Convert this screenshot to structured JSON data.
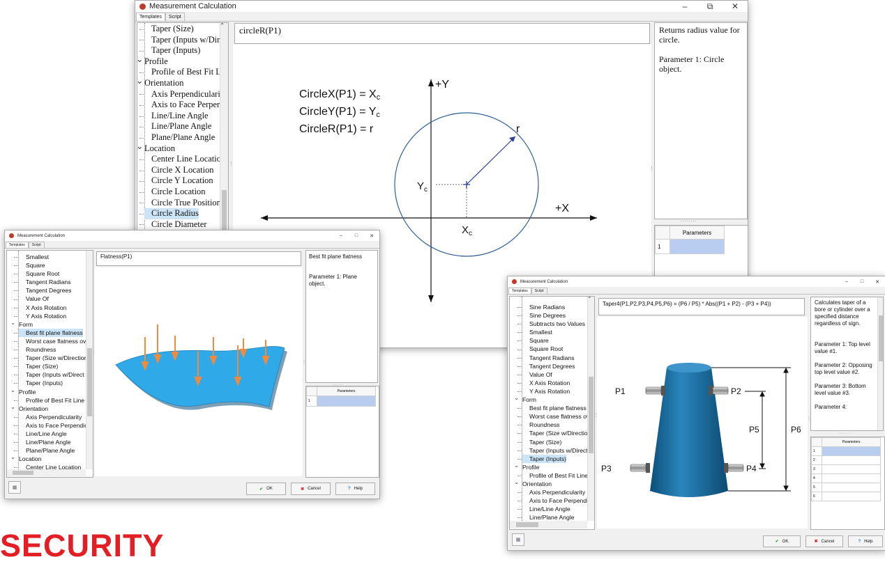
{
  "watermark_text": "SECURITY",
  "window_back": {
    "title": "Measurement Calculation",
    "tabs": [
      "Templates",
      "Script"
    ],
    "tree": [
      {
        "label": "Taper (Size)",
        "kind": "child"
      },
      {
        "label": "Taper (Inputs w/Dir",
        "kind": "child"
      },
      {
        "label": "Taper (Inputs)",
        "kind": "child"
      },
      {
        "label": "Profile",
        "kind": "cat"
      },
      {
        "label": "Profile of Best Fit L",
        "kind": "child"
      },
      {
        "label": "Orientation",
        "kind": "cat"
      },
      {
        "label": "Axis Perpendiculari",
        "kind": "child"
      },
      {
        "label": "Axis to Face Perper",
        "kind": "child"
      },
      {
        "label": "Line/Line Angle",
        "kind": "child"
      },
      {
        "label": "Line/Plane Angle",
        "kind": "child"
      },
      {
        "label": "Plane/Plane Angle",
        "kind": "child"
      },
      {
        "label": "Location",
        "kind": "cat"
      },
      {
        "label": "Center Line Locatio",
        "kind": "child"
      },
      {
        "label": "Circle X Location",
        "kind": "child"
      },
      {
        "label": "Circle Y Location",
        "kind": "child"
      },
      {
        "label": "Circle Location",
        "kind": "child"
      },
      {
        "label": "Circle True Position",
        "kind": "child"
      },
      {
        "label": "Circle Radius",
        "kind": "child",
        "selected": true
      },
      {
        "label": "Circle Diameter",
        "kind": "child"
      }
    ],
    "formula": "circleR(P1)",
    "description": [
      "Returns radius value for circle.",
      "Parameter 1: Circle object."
    ],
    "params_header": "Parameters",
    "param_rows": [
      "1"
    ],
    "diagram": {
      "eq1": "CircleX(P1) = X",
      "eq2": "CircleY(P1) = Y",
      "eq3": "CircleR(P1) = r",
      "sub": "c",
      "axis_y": "+Y",
      "axis_x": "+X",
      "r_label": "r",
      "yc": "Y",
      "xc": "X"
    }
  },
  "window_left": {
    "title": "Measurement Calculation",
    "tabs": [
      "Templates",
      "Script"
    ],
    "tree": [
      {
        "label": "Smallest",
        "kind": "child"
      },
      {
        "label": "Square",
        "kind": "child"
      },
      {
        "label": "Square Root",
        "kind": "child"
      },
      {
        "label": "Tangent Radians",
        "kind": "child"
      },
      {
        "label": "Tangent Degrees",
        "kind": "child"
      },
      {
        "label": "Value Of",
        "kind": "child"
      },
      {
        "label": "X Axis Rotation",
        "kind": "child"
      },
      {
        "label": "Y Axis Rotation",
        "kind": "child"
      },
      {
        "label": "Form",
        "kind": "cat"
      },
      {
        "label": "Best fit plane flatness",
        "kind": "child",
        "selected": true
      },
      {
        "label": "Worst case flatness ove",
        "kind": "child"
      },
      {
        "label": "Roundness",
        "kind": "child"
      },
      {
        "label": "Taper (Size w/Directior",
        "kind": "child"
      },
      {
        "label": "Taper (Size)",
        "kind": "child"
      },
      {
        "label": "Taper (Inputs w/Direct",
        "kind": "child"
      },
      {
        "label": "Taper (Inputs)",
        "kind": "child"
      },
      {
        "label": "Profile",
        "kind": "cat"
      },
      {
        "label": "Profile of Best Fit Line",
        "kind": "child"
      },
      {
        "label": "Orientation",
        "kind": "cat"
      },
      {
        "label": "Axis Perpendicularity",
        "kind": "child"
      },
      {
        "label": "Axis to Face Perpendic",
        "kind": "child"
      },
      {
        "label": "Line/Line Angle",
        "kind": "child"
      },
      {
        "label": "Line/Plane Angle",
        "kind": "child"
      },
      {
        "label": "Plane/Plane Angle",
        "kind": "child"
      },
      {
        "label": "Location",
        "kind": "cat"
      },
      {
        "label": "Center Line Location",
        "kind": "child"
      }
    ],
    "formula": "Flatness(P1)",
    "description": [
      "Best fit plane flatness",
      "Parameter 1: Plane object."
    ],
    "params_header": "Parameters",
    "param_rows": [
      "1"
    ],
    "buttons": {
      "ok": "OK",
      "cancel": "Cancel",
      "help": "Help"
    }
  },
  "window_right": {
    "title": "Measurement Calculation",
    "tabs": [
      "Templates",
      "Script"
    ],
    "tree": [
      {
        "label": "Sine Radians",
        "kind": "child"
      },
      {
        "label": "Sine Degrees",
        "kind": "child"
      },
      {
        "label": "Subtracts two Values",
        "kind": "child"
      },
      {
        "label": "Smallest",
        "kind": "child"
      },
      {
        "label": "Square",
        "kind": "child"
      },
      {
        "label": "Square Root",
        "kind": "child"
      },
      {
        "label": "Tangent Radians",
        "kind": "child"
      },
      {
        "label": "Tangent Degrees",
        "kind": "child"
      },
      {
        "label": "Value Of",
        "kind": "child"
      },
      {
        "label": "X Axis Rotation",
        "kind": "child"
      },
      {
        "label": "Y Axis Rotation",
        "kind": "child"
      },
      {
        "label": "Form",
        "kind": "cat"
      },
      {
        "label": "Best fit plane flatness",
        "kind": "child"
      },
      {
        "label": "Worst case flatness ove",
        "kind": "child"
      },
      {
        "label": "Roundness",
        "kind": "child"
      },
      {
        "label": "Taper (Size w/Directior",
        "kind": "child"
      },
      {
        "label": "Taper (Size)",
        "kind": "child"
      },
      {
        "label": "Taper (Inputs w/Direct",
        "kind": "child"
      },
      {
        "label": "Taper (Inputs)",
        "kind": "child",
        "selected": true
      },
      {
        "label": "Profile",
        "kind": "cat"
      },
      {
        "label": "Profile of Best Fit Line",
        "kind": "child"
      },
      {
        "label": "Orientation",
        "kind": "cat"
      },
      {
        "label": "Axis Perpendicularity",
        "kind": "child"
      },
      {
        "label": "Axis to Face Perpendic",
        "kind": "child"
      },
      {
        "label": "Line/Line Angle",
        "kind": "child"
      },
      {
        "label": "Line/Plane Angle",
        "kind": "child"
      }
    ],
    "formula": "Taper4(P1,P2,P3,P4,P5,P6) = (P6 / P5) * Abs((P1 + P2) - (P3 + P4))",
    "description": [
      "Calculates taper of a bore or cylinder over a specified distance regardless of sign.",
      "Parameter 1: Top level value #1.",
      "Parameter 2: Opposing top level value #2.",
      "Parameter 3: Bottom level value #3.",
      "Parameter 4:"
    ],
    "params_header": "Parameters",
    "param_rows": [
      "1",
      "2",
      "3",
      "4",
      "5",
      "6"
    ],
    "diagram": {
      "p1": "P1",
      "p2": "P2",
      "p3": "P3",
      "p4": "P4",
      "p5": "P5",
      "p6": "P6"
    },
    "buttons": {
      "ok": "OK",
      "cancel": "Cancel",
      "help": "Help"
    }
  }
}
